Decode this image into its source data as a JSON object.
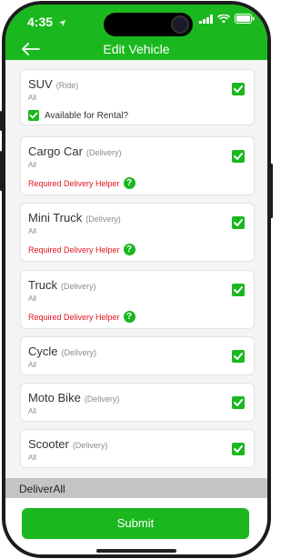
{
  "status_bar": {
    "time": "4:35"
  },
  "header": {
    "title": "Edit Vehicle"
  },
  "vehicles": [
    {
      "name": "SUV",
      "type": "(Ride)",
      "subtitle": "All",
      "checked": true,
      "rental_label": "Available for Rental?",
      "rental_checked": true
    },
    {
      "name": "Cargo Car",
      "type": "(Delivery)",
      "subtitle": "All",
      "checked": true,
      "helper_label": "Required Delivery Helper"
    },
    {
      "name": "Mini Truck",
      "type": "(Delivery)",
      "subtitle": "All",
      "checked": true,
      "helper_label": "Required Delivery Helper"
    },
    {
      "name": "Truck",
      "type": "(Delivery)",
      "subtitle": "All",
      "checked": true,
      "helper_label": "Required Delivery Helper"
    },
    {
      "name": "Cycle",
      "type": "(Delivery)",
      "subtitle": "All",
      "checked": true
    },
    {
      "name": "Moto Bike",
      "type": "(Delivery)",
      "subtitle": "All",
      "checked": true
    },
    {
      "name": "Scooter",
      "type": "(Delivery)",
      "subtitle": "All",
      "checked": true
    }
  ],
  "help_glyph": "?",
  "section": {
    "label": "DeliverAll"
  },
  "footer": {
    "submit_label": "Submit"
  },
  "colors": {
    "accent": "#1ab81e",
    "required": "#e0141e"
  }
}
